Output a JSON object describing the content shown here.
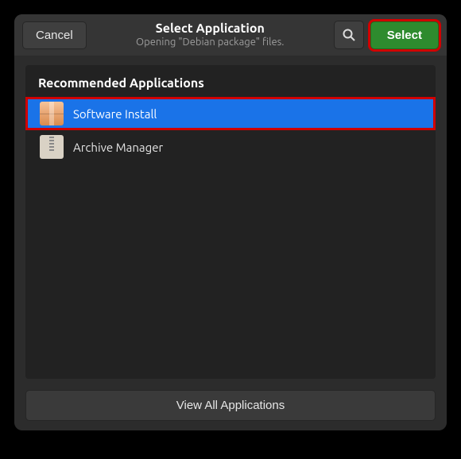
{
  "header": {
    "cancel_label": "Cancel",
    "title": "Select Application",
    "subtitle": "Opening \"Debian package\" files.",
    "select_label": "Select"
  },
  "section": {
    "heading": "Recommended Applications"
  },
  "apps": [
    {
      "name": "Software Install",
      "icon": "package-icon",
      "selected": true,
      "highlight": true
    },
    {
      "name": "Archive Manager",
      "icon": "archive-icon",
      "selected": false,
      "highlight": false
    }
  ],
  "footer": {
    "view_all_label": "View All Applications"
  }
}
